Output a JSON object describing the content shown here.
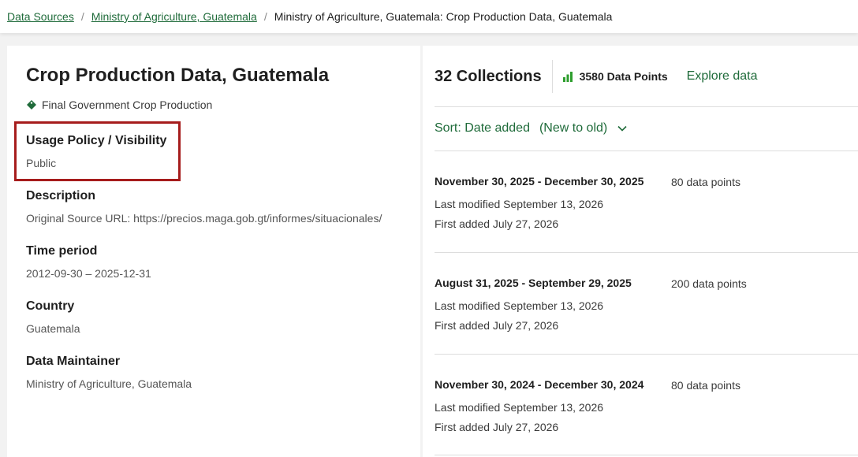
{
  "breadcrumb": {
    "items": [
      {
        "label": "Data Sources"
      },
      {
        "label": "Ministry of Agriculture, Guatemala"
      }
    ],
    "current": "Ministry of Agriculture, Guatemala: Crop Production Data, Guatemala",
    "separator": "/"
  },
  "dataset": {
    "title": "Crop Production Data, Guatemala",
    "tag": {
      "icon": "tag-icon",
      "label": "Final Government Crop Production"
    },
    "fields": {
      "usage": {
        "label": "Usage Policy / Visibility",
        "value": "Public"
      },
      "description": {
        "label": "Description",
        "value": "Original Source URL: https://precios.maga.gob.gt/informes/situacionales/"
      },
      "time_period": {
        "label": "Time period",
        "value": "2012-09-30 – 2025-12-31"
      },
      "country": {
        "label": "Country",
        "value": "Guatemala"
      },
      "maintainer": {
        "label": "Data Maintainer",
        "value": "Ministry of Agriculture, Guatemala"
      }
    }
  },
  "collections": {
    "count_label": "32 Collections",
    "points_icon": "bar-chart-icon",
    "points_label": "3580 Data Points",
    "explore_label": "Explore data",
    "sort": {
      "label": "Sort: Date added",
      "order": "(New to old)",
      "icon": "chevron-down-icon"
    },
    "items": [
      {
        "range": "November 30, 2025 - December 30, 2025",
        "points": "80 data points",
        "modified": "Last modified September 13, 2026",
        "added": "First added July 27, 2026"
      },
      {
        "range": "August 31, 2025 - September 29, 2025",
        "points": "200 data points",
        "modified": "Last modified September 13, 2026",
        "added": "First added July 27, 2026"
      },
      {
        "range": "November 30, 2024 - December 30, 2024",
        "points": "80 data points",
        "modified": "Last modified September 13, 2026",
        "added": "First added July 27, 2026"
      }
    ]
  },
  "colors": {
    "link_green": "#1f6b3a",
    "bar_green": "#2e9e2e",
    "highlight_red": "#a61c1c"
  }
}
